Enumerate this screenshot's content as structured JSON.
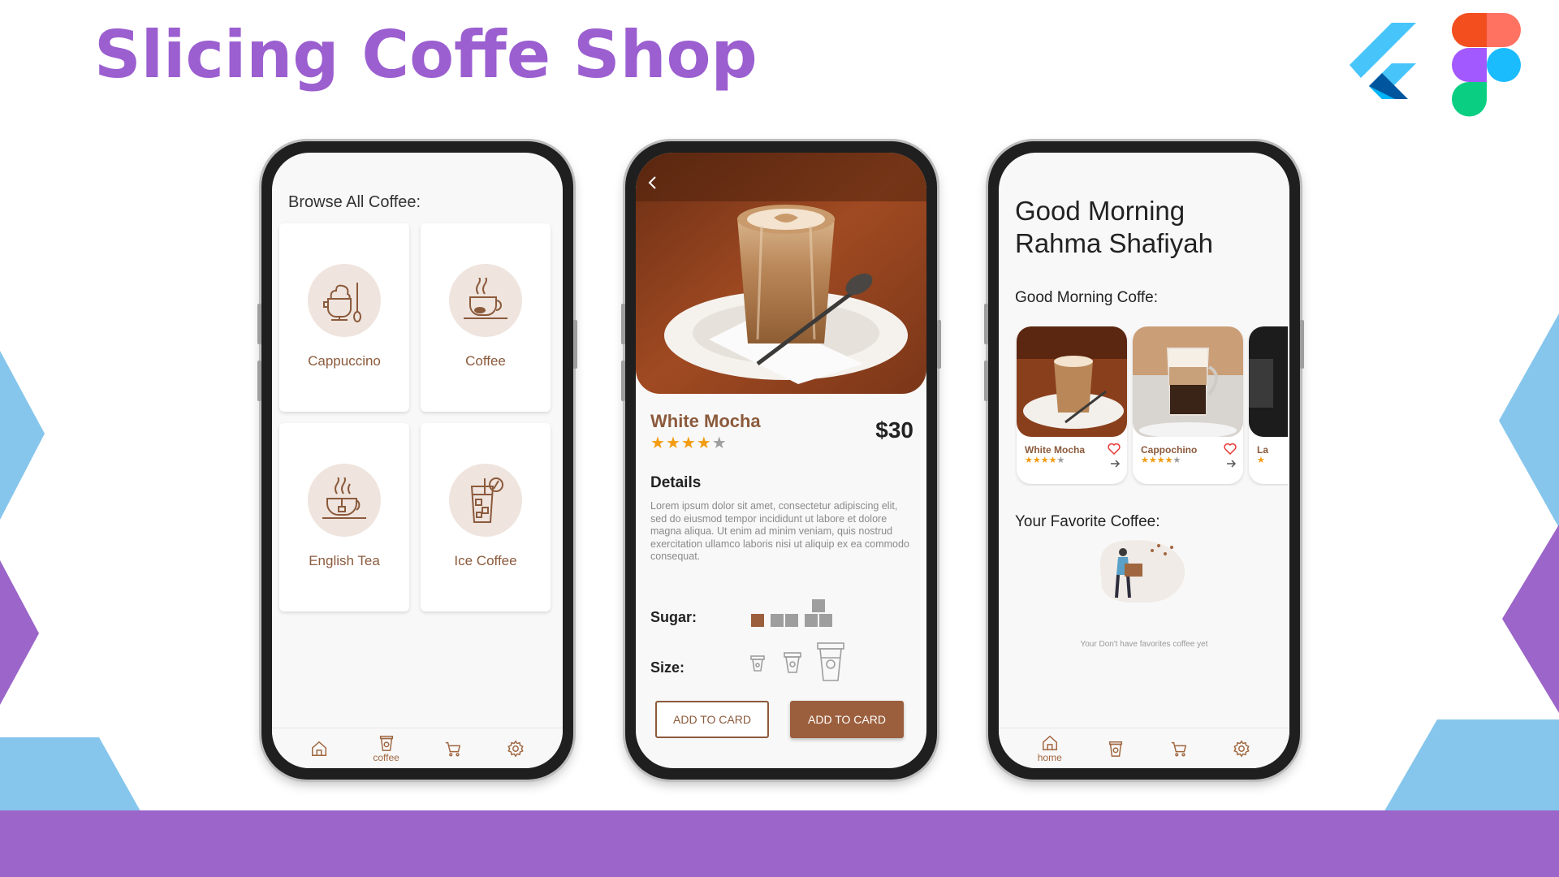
{
  "header": {
    "title": "Slicing Coffe Shop",
    "logos": [
      "flutter-logo",
      "figma-logo"
    ]
  },
  "colors": {
    "title_purple": "#9b5fd0",
    "band_purple": "#9b65c9",
    "sky_blue": "#86c6ec",
    "coffee_brown": "#8b5a3c",
    "button_brown": "#9c5f3d",
    "star_orange": "#f39c12"
  },
  "phone_browse": {
    "title": "Browse All Coffee:",
    "categories": [
      {
        "label": "Cappuccino",
        "icon": "cappuccino-icon"
      },
      {
        "label": "Coffee",
        "icon": "coffee-cup-icon"
      },
      {
        "label": "English Tea",
        "icon": "tea-cup-icon"
      },
      {
        "label": "Ice Coffee",
        "icon": "ice-coffee-icon"
      }
    ],
    "nav": {
      "items": [
        {
          "icon": "home-icon",
          "label": ""
        },
        {
          "icon": "coffee-icon",
          "label": "coffee"
        },
        {
          "icon": "cart-icon",
          "label": ""
        },
        {
          "icon": "settings-icon",
          "label": ""
        }
      ]
    }
  },
  "phone_detail": {
    "product_name": "White Mocha",
    "rating": 4,
    "max_rating": 5,
    "price": "$30",
    "details_title": "Details",
    "details_text": "Lorem ipsum dolor sit amet, consectetur adipiscing elit, sed do eiusmod tempor incididunt ut labore et dolore magna aliqua. Ut enim ad minim veniam, quis nostrud exercitation ullamco laboris nisi ut aliquip ex ea commodo consequat.",
    "sugar_label": "Sugar:",
    "sugar_selected": 1,
    "size_label": "Size:",
    "size_options": [
      "small",
      "medium",
      "large"
    ],
    "button_outline": "ADD TO CARD",
    "button_fill": "ADD TO CARD"
  },
  "phone_home": {
    "greeting_line1": "Good Morning",
    "greeting_line2": "Rahma Shafiyah",
    "section_morning": "Good Morning Coffe:",
    "cards": [
      {
        "name": "White Mocha",
        "rating": 4
      },
      {
        "name": "Cappochino",
        "rating": 4
      },
      {
        "name": "La",
        "rating": 1
      }
    ],
    "section_favorite": "Your Favorite Coffee:",
    "empty_text": "Your Don't have favorites coffee yet",
    "nav": {
      "items": [
        {
          "icon": "home-icon",
          "label": "home"
        },
        {
          "icon": "coffee-icon",
          "label": ""
        },
        {
          "icon": "cart-icon",
          "label": ""
        },
        {
          "icon": "settings-icon",
          "label": ""
        }
      ]
    }
  }
}
